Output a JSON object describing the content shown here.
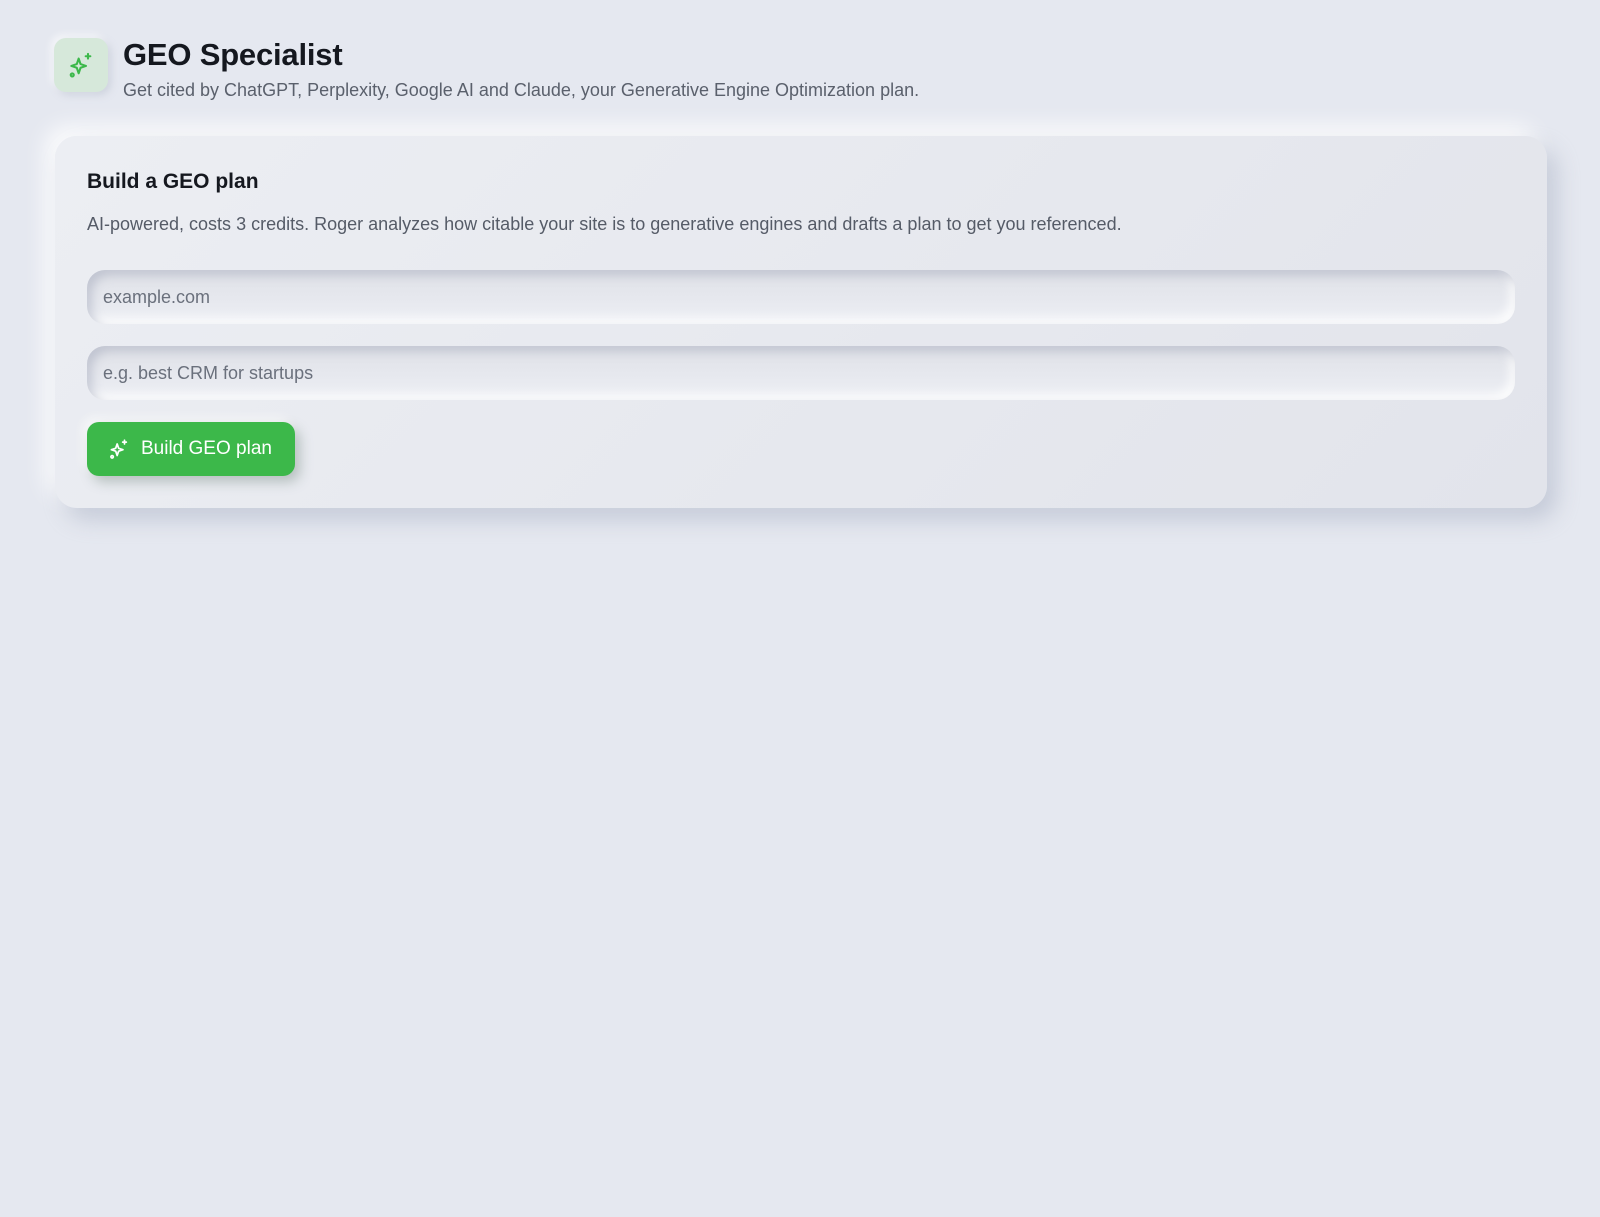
{
  "header": {
    "title": "GEO Specialist",
    "subtitle": "Get cited by ChatGPT, Perplexity, Google AI and Claude, your Generative Engine Optimization plan.",
    "icon": "sparkles-icon"
  },
  "card": {
    "title": "Build a GEO plan",
    "description": "AI-powered, costs 3 credits. Roger analyzes how citable your site is to generative engines and drafts a plan to get you referenced.",
    "domain_field": {
      "value": "",
      "placeholder": "example.com"
    },
    "query_field": {
      "value": "",
      "placeholder": "e.g. best CRM for startups"
    },
    "build_button": {
      "label": "Build GEO plan",
      "icon": "sparkles-icon"
    }
  },
  "colors": {
    "background": "#e5e8f0",
    "accent": "#3cb84a",
    "icon_tile": "#d6e8da"
  }
}
